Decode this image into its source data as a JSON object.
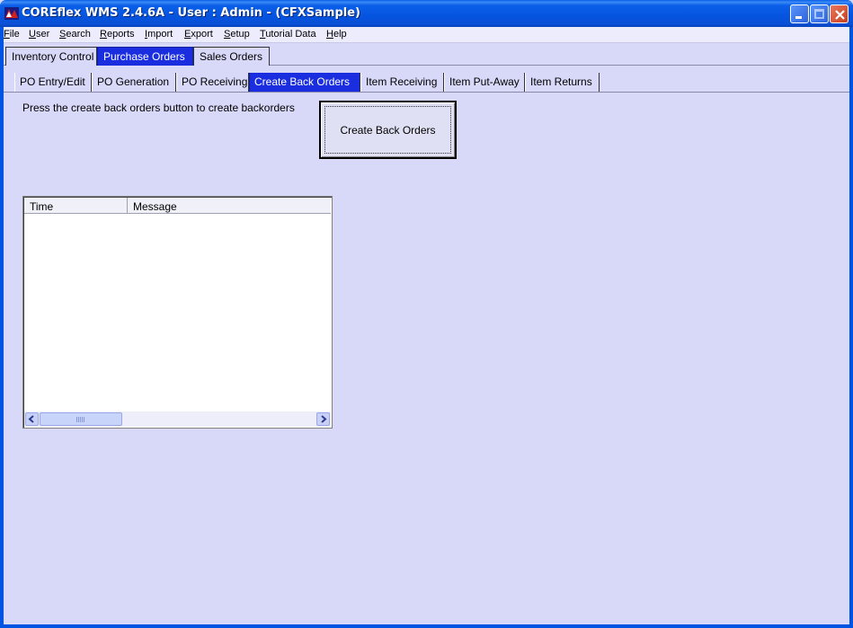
{
  "window": {
    "title": "COREflex WMS 2.4.6A - User : Admin - (CFXSample)"
  },
  "menu": [
    {
      "label": "File",
      "mnemonic": "F",
      "rest": "ile"
    },
    {
      "label": "User",
      "mnemonic": "U",
      "rest": "ser"
    },
    {
      "label": "Search",
      "mnemonic": "S",
      "rest": "earch"
    },
    {
      "label": "Reports",
      "mnemonic": "R",
      "rest": "eports"
    },
    {
      "label": "Import",
      "mnemonic": "I",
      "rest": "mport"
    },
    {
      "label": "Export",
      "mnemonic": "E",
      "rest": "xport"
    },
    {
      "label": "Setup",
      "mnemonic": "S",
      "rest": "etup"
    },
    {
      "label": "Tutorial Data",
      "mnemonic": "T",
      "rest": "utorial Data"
    },
    {
      "label": "Help",
      "mnemonic": "H",
      "rest": "elp"
    }
  ],
  "main_tabs": [
    {
      "label": "Inventory Control",
      "active": false
    },
    {
      "label": "Purchase Orders",
      "active": true
    },
    {
      "label": "Sales Orders",
      "active": false
    }
  ],
  "sub_tabs": [
    {
      "label": "PO Entry/Edit",
      "active": false
    },
    {
      "label": "PO Generation",
      "active": false
    },
    {
      "label": "PO Receiving",
      "active": false
    },
    {
      "label": "Create Back Orders",
      "active": true
    },
    {
      "label": "Item Receiving",
      "active": false
    },
    {
      "label": "Item Put-Away",
      "active": false
    },
    {
      "label": "Item Returns",
      "active": false
    }
  ],
  "content": {
    "instructions": "Press the create back orders button to create backorders",
    "create_button": "Create Back Orders"
  },
  "log_table": {
    "columns": [
      "Time",
      "Message"
    ],
    "rows": []
  },
  "colors": {
    "active_tab": "#1a2ee0",
    "background": "#d8d8f8",
    "titlebar": "#0054e3"
  }
}
